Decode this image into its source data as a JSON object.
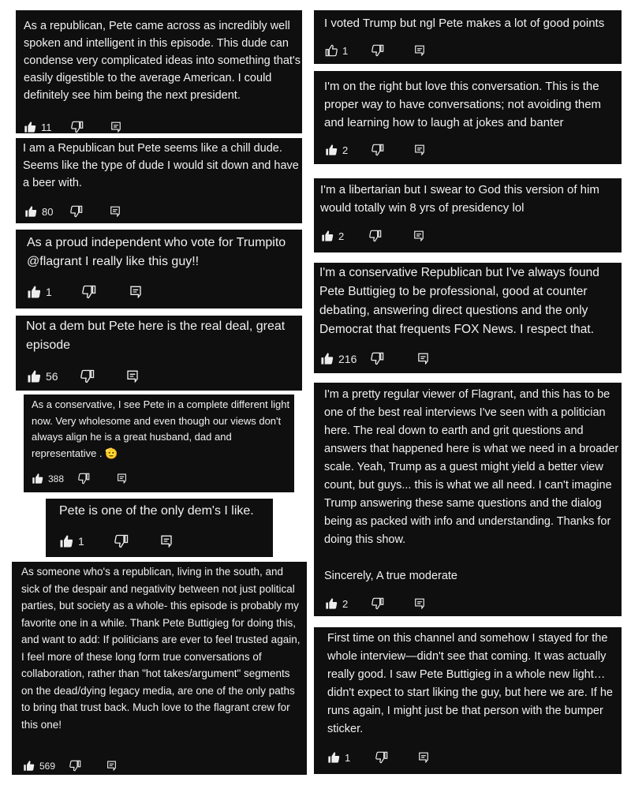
{
  "comments": [
    {
      "id": "c1",
      "text": "As a republican, Pete came across as incredibly well spoken and intelligent in this episode. This dude can condense very complicated ideas into something that's easily digestible to the average American. I could definitely see him being the next president.",
      "likes": "11"
    },
    {
      "id": "c2",
      "text": "I am a Republican but Pete seems like a chill dude. Seems like the type of dude I would sit down and have a beer with.",
      "likes": "80"
    },
    {
      "id": "c3",
      "text": "As a proud independent who vote for Trumpito @flagrant I really like this guy!!",
      "likes": "1"
    },
    {
      "id": "c4",
      "text": "Not a dem but Pete here is the real deal, great episode",
      "likes": "56"
    },
    {
      "id": "c5",
      "text": "As a conservative, I see Pete in a complete different light now. Very wholesome and even though our views don't always align he is a great husband, dad and representative . 🫡",
      "likes": "388"
    },
    {
      "id": "c6",
      "text": "Pete is one of the only dem's I like.",
      "likes": "1"
    },
    {
      "id": "c7",
      "text": "As someone who's a republican, living in the south, and sick of the despair and negativity between not just political parties, but society as a whole- this episode is probably my favorite one in a while. Thank Pete Buttigieg for doing this, and want to add: If politicians are ever to feel trusted again, I feel more of these long form true conversations of collaboration, rather than \"hot takes/argument\" segments on the dead/dying legacy media, are one of the only paths to bring that trust back. Much love to the flagrant crew for this one!",
      "likes": "569"
    },
    {
      "id": "c8",
      "text": "I voted Trump but ngl Pete makes a lot of good points",
      "likes": "1"
    },
    {
      "id": "c9",
      "text": "I'm on the right but love this conversation.  This is the proper way to have conversations; not avoiding them and learning how to laugh at jokes and banter",
      "likes": "2"
    },
    {
      "id": "c10",
      "text": "I'm a libertarian but I swear to God this version of him would totally win 8 yrs of presidency lol",
      "likes": "2"
    },
    {
      "id": "c11",
      "text": "I'm a conservative Republican but I've always found Pete Buttigieg to be professional, good at counter debating, answering direct questions and the only Democrat that frequents FOX News. I respect that.",
      "likes": "216"
    },
    {
      "id": "c12",
      "text": "I'm a pretty regular viewer of Flagrant, and this has to be one of the best real interviews I've seen with a politician here.  The real down to earth and grit questions and answers that happened here is what we need in a broader scale.  Yeah, Trump as a guest might yield a better view count, but guys... this is what we all need.  I can't imagine Trump answering these same questions and the dialog being as packed with info and understanding.  Thanks for doing this show.",
      "sign": "Sincerely,  A true moderate",
      "likes": "2"
    },
    {
      "id": "c13",
      "text": "First time on this channel and somehow I stayed for the whole interview—didn't see that coming. It was actually really good. I saw Pete Buttigieg in a whole new light… didn't expect to start liking the guy, but here we are. If he runs again, I might just be that person with the bumper sticker.",
      "likes": "1"
    }
  ],
  "icons": {
    "like": "thumbs-up-icon",
    "dislike": "thumbs-down-icon",
    "reply": "reply-icon"
  },
  "colors": {
    "card_bg": "#0f0f0f",
    "text": "#f1f1f1",
    "page_bg": "#ffffff"
  }
}
